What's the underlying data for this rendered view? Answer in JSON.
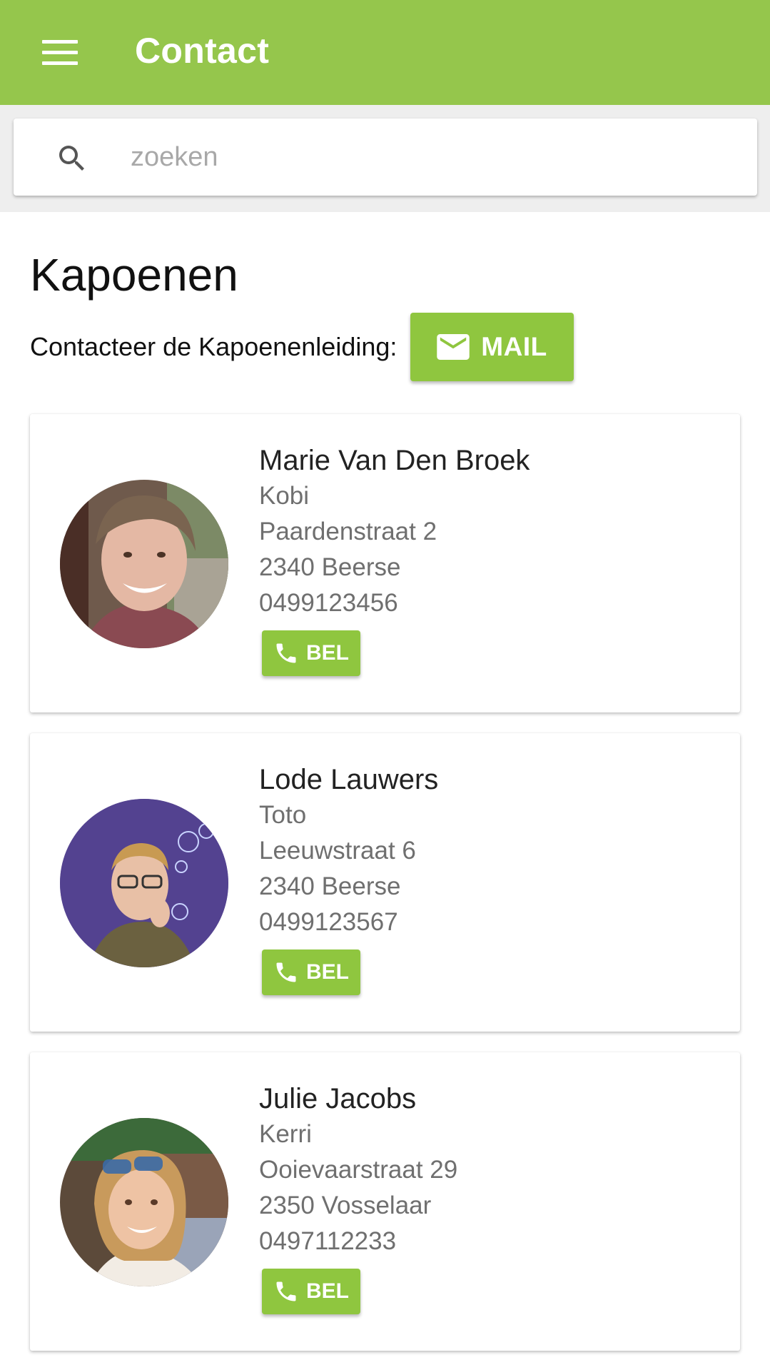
{
  "appbar": {
    "title": "Contact",
    "menu_icon": "menu-icon",
    "color": "#95c64c"
  },
  "search": {
    "placeholder": "zoeken",
    "value": "",
    "icon": "search-icon"
  },
  "section": {
    "title": "Kapoenen",
    "contact_label": "Contacteer de Kapoenenleiding:",
    "mail_label": "MAIL",
    "mail_icon": "mail-icon"
  },
  "contacts": [
    {
      "name": "Marie Van Den Broek",
      "nickname": "Kobi",
      "street": "Paardenstraat 2",
      "city": "2340 Beerse",
      "phone": "0499123456",
      "call_label": "BEL"
    },
    {
      "name": "Lode Lauwers",
      "nickname": "Toto",
      "street": "Leeuwstraat 6",
      "city": "2340 Beerse",
      "phone": "0499123567",
      "call_label": "BEL"
    },
    {
      "name": "Julie Jacobs",
      "nickname": "Kerri",
      "street": "Ooievaarstraat 29",
      "city": "2350 Vosselaar",
      "phone": "0497112233",
      "call_label": "BEL"
    }
  ],
  "colors": {
    "accent": "#8fc63f",
    "appbar": "#95c64c"
  }
}
